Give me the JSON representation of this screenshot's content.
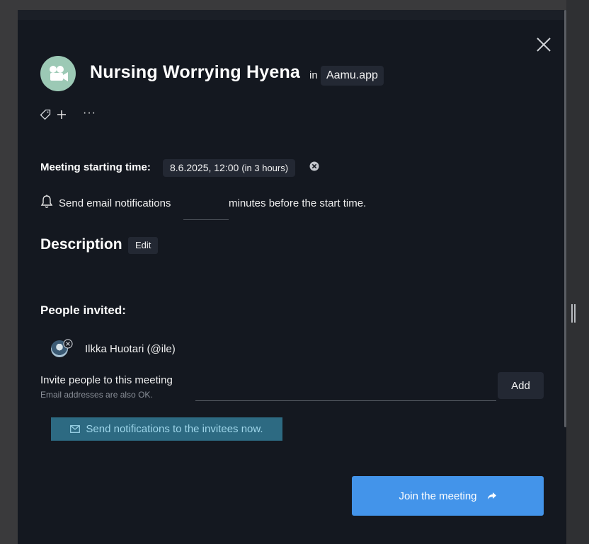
{
  "meeting": {
    "title": "Nursing Worrying Hyena",
    "in_label": "in",
    "workspace": "Aamu.app",
    "more_label": "···"
  },
  "schedule": {
    "label": "Meeting starting time:",
    "datetime": "8.6.2025, 12:00",
    "relative": "(in 3 hours)"
  },
  "notifications": {
    "before_text": "Send email notifications",
    "minutes_value": "",
    "after_text": "minutes before the start time."
  },
  "description": {
    "heading": "Description",
    "edit_label": "Edit"
  },
  "people": {
    "heading": "People invited:",
    "invitees": [
      {
        "name": "Ilkka Huotari (@ile)"
      }
    ]
  },
  "invite": {
    "label": "Invite people to this meeting",
    "hint": "Email addresses are also OK.",
    "input_value": "",
    "add_label": "Add"
  },
  "actions": {
    "notify_label": "Send notifications to the invitees now.",
    "join_label": "Join the meeting"
  },
  "colors": {
    "modal_bg": "#141820",
    "chip_bg": "#232833",
    "room_avatar": "#9cc9b5",
    "notify_bg": "#2d6a82",
    "notify_text": "#9fd6ea",
    "join_bg": "#4394ea"
  },
  "icons": {
    "room": "video-camera-icon",
    "tag": "tag-icon",
    "add": "plus-icon",
    "bell": "bell-icon",
    "close": "close-icon",
    "clear": "circle-x-icon",
    "mail": "envelope-icon",
    "join": "share-arrow-icon"
  }
}
